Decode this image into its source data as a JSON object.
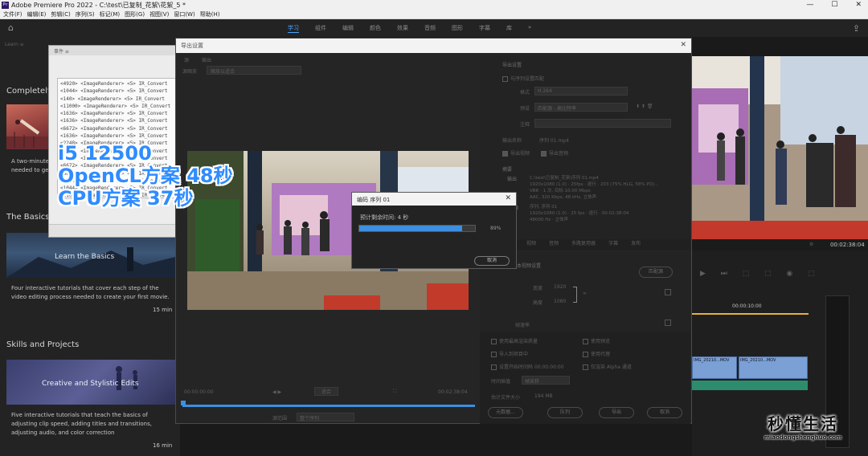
{
  "window": {
    "title": "Adobe Premiere Pro 2022 - C:\\test\\已复制_花絮\\花絮_5 *",
    "controls": [
      "—",
      "☐",
      "✕"
    ]
  },
  "menu": [
    "文件(F)",
    "编辑(E)",
    "剪辑(C)",
    "序列(S)",
    "标记(M)",
    "图形(G)",
    "视图(V)",
    "窗口(W)",
    "帮助(H)"
  ],
  "workspaces": {
    "tabs": [
      "学习",
      "组件",
      "编辑",
      "颜色",
      "效果",
      "音频",
      "图形",
      "字幕",
      "库"
    ],
    "active": "学习",
    "more": "»"
  },
  "learn": {
    "panel_label": "Learn  ≡",
    "section_completely": "Completely",
    "completely_desc": "A two-minute\nneeded to get",
    "section_basics": "The Basics",
    "basics_thumb_caption": "Learn the Basics",
    "basics_desc": "Four interactive tutorials that cover each step of the video editing process needed to create your first movie.",
    "basics_min": "15 min",
    "section_skills": "Skills and Projects",
    "skills_thumb_caption": "Creative and Stylistic Edits",
    "skills_desc": "Five interactive tutorials that teach the basics of adjusting clip speed, adding titles and transitions, adjusting audio, and color correction",
    "skills_min": "16 min"
  },
  "events_panel": {
    "header": "事件 ≡",
    "log_lines": [
      "<4920> <ImageRenderer> <5> IR_Convert",
      "<1044> <ImageRenderer> <5> IR_Convert",
      "<140> <ImageRenderer> <5> IR_Convert",
      "<11000> <ImageRenderer> <5> IR_Convert",
      "<1636> <ImageRenderer> <5> IR_Convert",
      "<1636> <ImageRenderer> <5> IR_Convert",
      "<6672> <ImageRenderer> <5> IR_Convert",
      "<1636> <ImageRenderer> <5> IR_Convert",
      "<2248> <ImageRenderer> <5> IR_Convert",
      "<2248> <ImageRenderer> <5> IR_Convert",
      "<6672> <ImageRenderer> <5> IR_Convert",
      "<6672> <ImageRenderer> <5> IR_Convert",
      "<6672> <ImageRenderer> <5> IR_Convert",
      "<1636> <ImageRenderer> <5> IR_Convert",
      "<1044> <ImageRenderer> <5> IR_Convert",
      "<11000> <ImageRenderer> <5> IR_Convert"
    ]
  },
  "overlay": {
    "line1": "i5 12500",
    "line2": "OpenCL方案 48秒",
    "line3": "CPU方案 37秒"
  },
  "export_dialog": {
    "title": "导出设置",
    "tabs": [
      "源",
      "输出"
    ],
    "source_scaling_label": "源缩放",
    "source_scaling_value": "缩放以适合",
    "export_settings_heading": "导出设置",
    "match_sequence": "与序列设置匹配",
    "format_label": "格式",
    "format_value": "H.264",
    "preset_label": "预设",
    "preset_value": "匹配源 - 高比特率",
    "comments_label": "注释",
    "output_name_label": "输出名称",
    "output_name_value": "序列 01.mp4",
    "export_video": "导出视频",
    "export_audio": "导出音频",
    "summary_heading": "摘要",
    "summary_output_label": "输出",
    "summary_output_lines": [
      "C:\\test\\已复制_花絮\\序列 01.mp4",
      "1920x1080 (1.0) · 25fps · 逐行 · 203 (75% HLG, 58% PQ)...",
      "VBR · 1 次, 目标 10.00 Mbps",
      "AAC, 320 Kbps, 48 kHz, 立体声"
    ],
    "summary_source_label": "源",
    "summary_source_lines": [
      "序列, 序列 01",
      "1920x1080 (1.0) · 25 fps · 逐行 · 00:02:38:04",
      "48000 Hz · 立体声"
    ],
    "settings_tabs": [
      "效果",
      "视频",
      "音频",
      "多路复用器",
      "字幕",
      "发布"
    ],
    "basic_video_heading": "基本视频设置",
    "match_source_button": "匹配源",
    "width_label": "宽度",
    "width_value": "1920",
    "height_label": "高度",
    "height_value": "1080",
    "frame_rate_label": "帧速率",
    "options": [
      "使用最高渲染质量",
      "使用预览",
      "导入到项目中",
      "设置开始时间码",
      "仅渲染 Alpha 通道",
      "使用代理"
    ],
    "start_timecode": "00:00:00:00",
    "time_interp_label": "时间插值",
    "time_interp_value": "帧采样",
    "file_size_label": "估计文件大小",
    "file_size_value": "194 MB",
    "metadata_button": "元数据...",
    "queue_button": "队列",
    "export_button": "导出",
    "cancel_button": "取消",
    "tc_start": "00:00:00:00",
    "tc_end": "00:02:38:04",
    "fit_label": "适合",
    "source_range_label": "源范围",
    "source_range_value": "整个序列",
    "range_label": "入点/出点"
  },
  "encode_dialog": {
    "title": "编码 序列 01",
    "remaining": "预计剩余时间: 4 秒",
    "percent_text": "89%",
    "progress": 0.89,
    "cancel": "取消"
  },
  "program": {
    "timecode": "00:02:38:04",
    "ruler_tc": "00:00:10:00",
    "clip1": "IMG_20210...MOV",
    "clip2": "IMG_20210...MOV"
  },
  "watermark": {
    "title": "秒懂生活",
    "url": "miaodongshenghuo.com"
  }
}
